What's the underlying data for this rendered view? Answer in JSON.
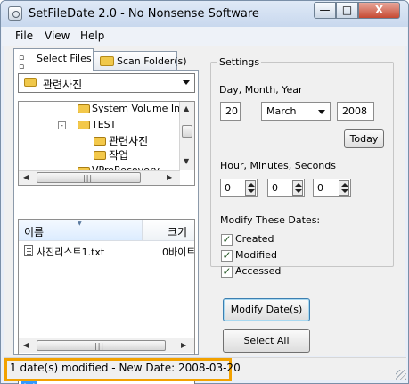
{
  "window": {
    "title": "SetFileDate 2.0 - No Nonsense Software",
    "buttons": {
      "minimize": "—",
      "maximize": "□",
      "close": "X"
    }
  },
  "menu": [
    "File",
    "View",
    "Help"
  ],
  "tabs": [
    {
      "label": "Select Files",
      "icon": "files-icon"
    },
    {
      "label": "Scan Folder(s)",
      "icon": "folder-icon"
    }
  ],
  "left_panel": {
    "drive_combo": "관련사진",
    "tree": {
      "items": [
        {
          "label": "System Volume Inform",
          "icon": "folder-icon"
        },
        {
          "label": "TEST",
          "icon": "folder-open-icon",
          "expander": "-"
        },
        {
          "label": "관련사진",
          "icon": "folder-icon"
        },
        {
          "label": "작업",
          "icon": "folder-icon"
        },
        {
          "label": "VProRecovery",
          "icon": "folder-icon"
        }
      ],
      "scroll_marks": {
        "up": "▲",
        "down": "▼",
        "left": "◀",
        "right": "▶",
        "grip": "|||"
      }
    },
    "file_list": {
      "columns": [
        "이름",
        "크기"
      ],
      "sort_mark": "▼",
      "rows": [
        {
          "name": "사진리스트1.txt",
          "size": "0바이트"
        }
      ]
    },
    "filter_combo": "*.*"
  },
  "settings": {
    "group_title": "Settings",
    "date_label": "Day, Month, Year",
    "day": "20",
    "month": "March",
    "year": "2008",
    "today_button": "Today",
    "time_label": "Hour, Minutes, Seconds",
    "hour": "0",
    "minutes": "0",
    "seconds": "0",
    "modify_label": "Modify These Dates:",
    "checkboxes": [
      {
        "label": "Created",
        "checked": true,
        "mark": "✓"
      },
      {
        "label": "Modified",
        "checked": true,
        "mark": "✓"
      },
      {
        "label": "Accessed",
        "checked": true,
        "mark": "✓"
      }
    ]
  },
  "actions": {
    "modify": "Modify Date(s)",
    "select_all": "Select All"
  },
  "status": {
    "text": "1 date(s) modified - New Date: 2008-03-20",
    "highlight_color": "#f2a100"
  }
}
